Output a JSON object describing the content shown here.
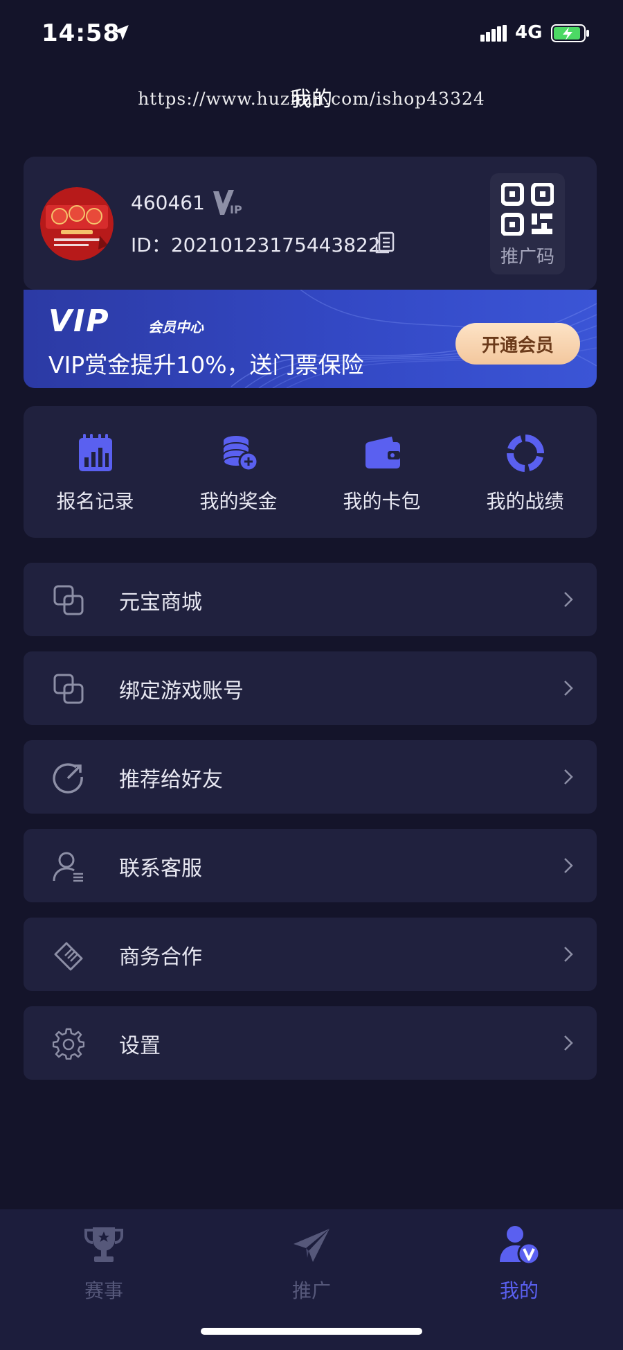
{
  "status_bar": {
    "time": "14:58",
    "network": "4G"
  },
  "header": {
    "title": "我的",
    "watermark": "https://www.huzhan.com/ishop43324"
  },
  "profile": {
    "username": "460461",
    "user_id": "ID：20210123175443822",
    "promo_code_label": "推广码"
  },
  "vip_banner": {
    "logo": "VIP",
    "center": "会员中心",
    "description": "VIP赏金提升10%，送门票保险",
    "button": "开通会员"
  },
  "quick_actions": [
    {
      "label": "报名记录",
      "icon": "calendar-chart-icon"
    },
    {
      "label": "我的奖金",
      "icon": "coins-icon"
    },
    {
      "label": "我的卡包",
      "icon": "wallet-icon"
    },
    {
      "label": "我的战绩",
      "icon": "ring-chart-icon"
    }
  ],
  "menu": [
    {
      "label": "元宝商城",
      "icon": "overlap-squares-icon"
    },
    {
      "label": "绑定游戏账号",
      "icon": "overlap-squares-icon"
    },
    {
      "label": "推荐给好友",
      "icon": "share-arrow-icon"
    },
    {
      "label": "联系客服",
      "icon": "user-list-icon"
    },
    {
      "label": "商务合作",
      "icon": "handshake-icon"
    },
    {
      "label": "设置",
      "icon": "gear-icon"
    }
  ],
  "tabs": [
    {
      "label": "赛事",
      "icon": "trophy-icon",
      "active": false
    },
    {
      "label": "推广",
      "icon": "paper-plane-icon",
      "active": false
    },
    {
      "label": "我的",
      "icon": "user-vip-icon",
      "active": true
    }
  ],
  "colors": {
    "background": "#14142a",
    "card": "#20213e",
    "accent": "#5a60f0",
    "tab_inactive": "#56587a",
    "vip_button": "#f3c79d"
  }
}
